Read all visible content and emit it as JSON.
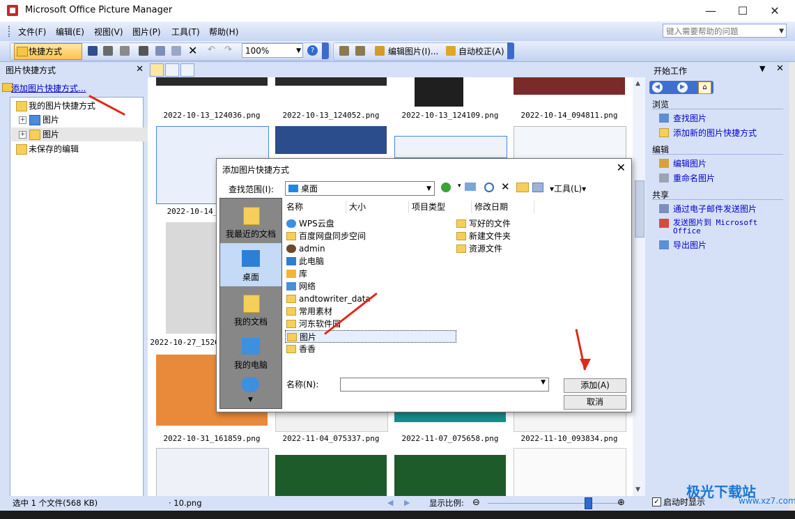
{
  "window": {
    "title": "Microsoft Office Picture Manager",
    "controls": [
      "—",
      "☐",
      "✕"
    ]
  },
  "menu": {
    "items": [
      "文件(F)",
      "编辑(E)",
      "视图(V)",
      "图片(P)",
      "工具(T)",
      "帮助(H)"
    ],
    "help_placeholder": "键入需要帮助的问题"
  },
  "toolbar": {
    "shortcut_label": "快捷方式(S)...",
    "zoom_value": "100%",
    "edit_pictures_label": "编辑图片(I)...",
    "auto_correct_label": "自动校正(A)"
  },
  "left_pane": {
    "title": "图片快捷方式",
    "add_link": "添加图片快捷方式...",
    "tree": [
      {
        "label": "我的图片快捷方式",
        "level": 0
      },
      {
        "label": "图片",
        "level": 1
      },
      {
        "label": "图片",
        "level": 1
      },
      {
        "label": "未保存的编辑",
        "level": 0
      }
    ],
    "status": "选中 1 个文件(568 KB)"
  },
  "thumbnails": {
    "labels": [
      "2022-10-13_124036.png",
      "2022-10-13_124052.png",
      "2022-10-13_124109.png",
      "2022-10-14_094811.png",
      "2022-10-14_",
      "2022-10-27_1526",
      "2022-10-31_161859.png",
      "2022-11-04_075337.png",
      "2022-11-07_075658.png",
      "2022-11-10_093834.png"
    ]
  },
  "center_status": {
    "file": "· 10.png",
    "zoom_label": "显示比例:"
  },
  "right_pane": {
    "title": "开始工作",
    "sections": [
      {
        "heading": "浏览",
        "items": [
          "查找图片",
          "添加新的图片快捷方式"
        ]
      },
      {
        "heading": "编辑",
        "items": [
          "编辑图片",
          "重命名图片"
        ]
      },
      {
        "heading": "共享",
        "items": [
          "通过电子邮件发送图片",
          "发送图片到 Microsoft Office",
          "导出图片"
        ]
      }
    ],
    "show_on_startup": "启动时显示"
  },
  "dialog": {
    "title": "添加图片快捷方式",
    "look_in_label": "查找范围(I):",
    "look_in_value": "桌面",
    "tools_label": "工具(L)",
    "places": [
      "我最近的文档",
      "桌面",
      "我的文档",
      "我的电脑"
    ],
    "columns": [
      "名称",
      "大小",
      "项目类型",
      "修改日期"
    ],
    "files_col1": [
      "WPS云盘",
      "百度网盘同步空间",
      "admin",
      "此电脑",
      "库",
      "网络",
      "andtowriter_data",
      "常用素材",
      "河东软件园",
      "图片",
      "香香"
    ],
    "files_col2": [
      "写好的文件",
      "新建文件夹",
      "资源文件"
    ],
    "name_label": "名称(N):",
    "name_value": "",
    "add_button": "添加(A)",
    "cancel_button": "取消"
  },
  "watermark": {
    "text": "极光下载站",
    "url": "www.xz7.com"
  }
}
